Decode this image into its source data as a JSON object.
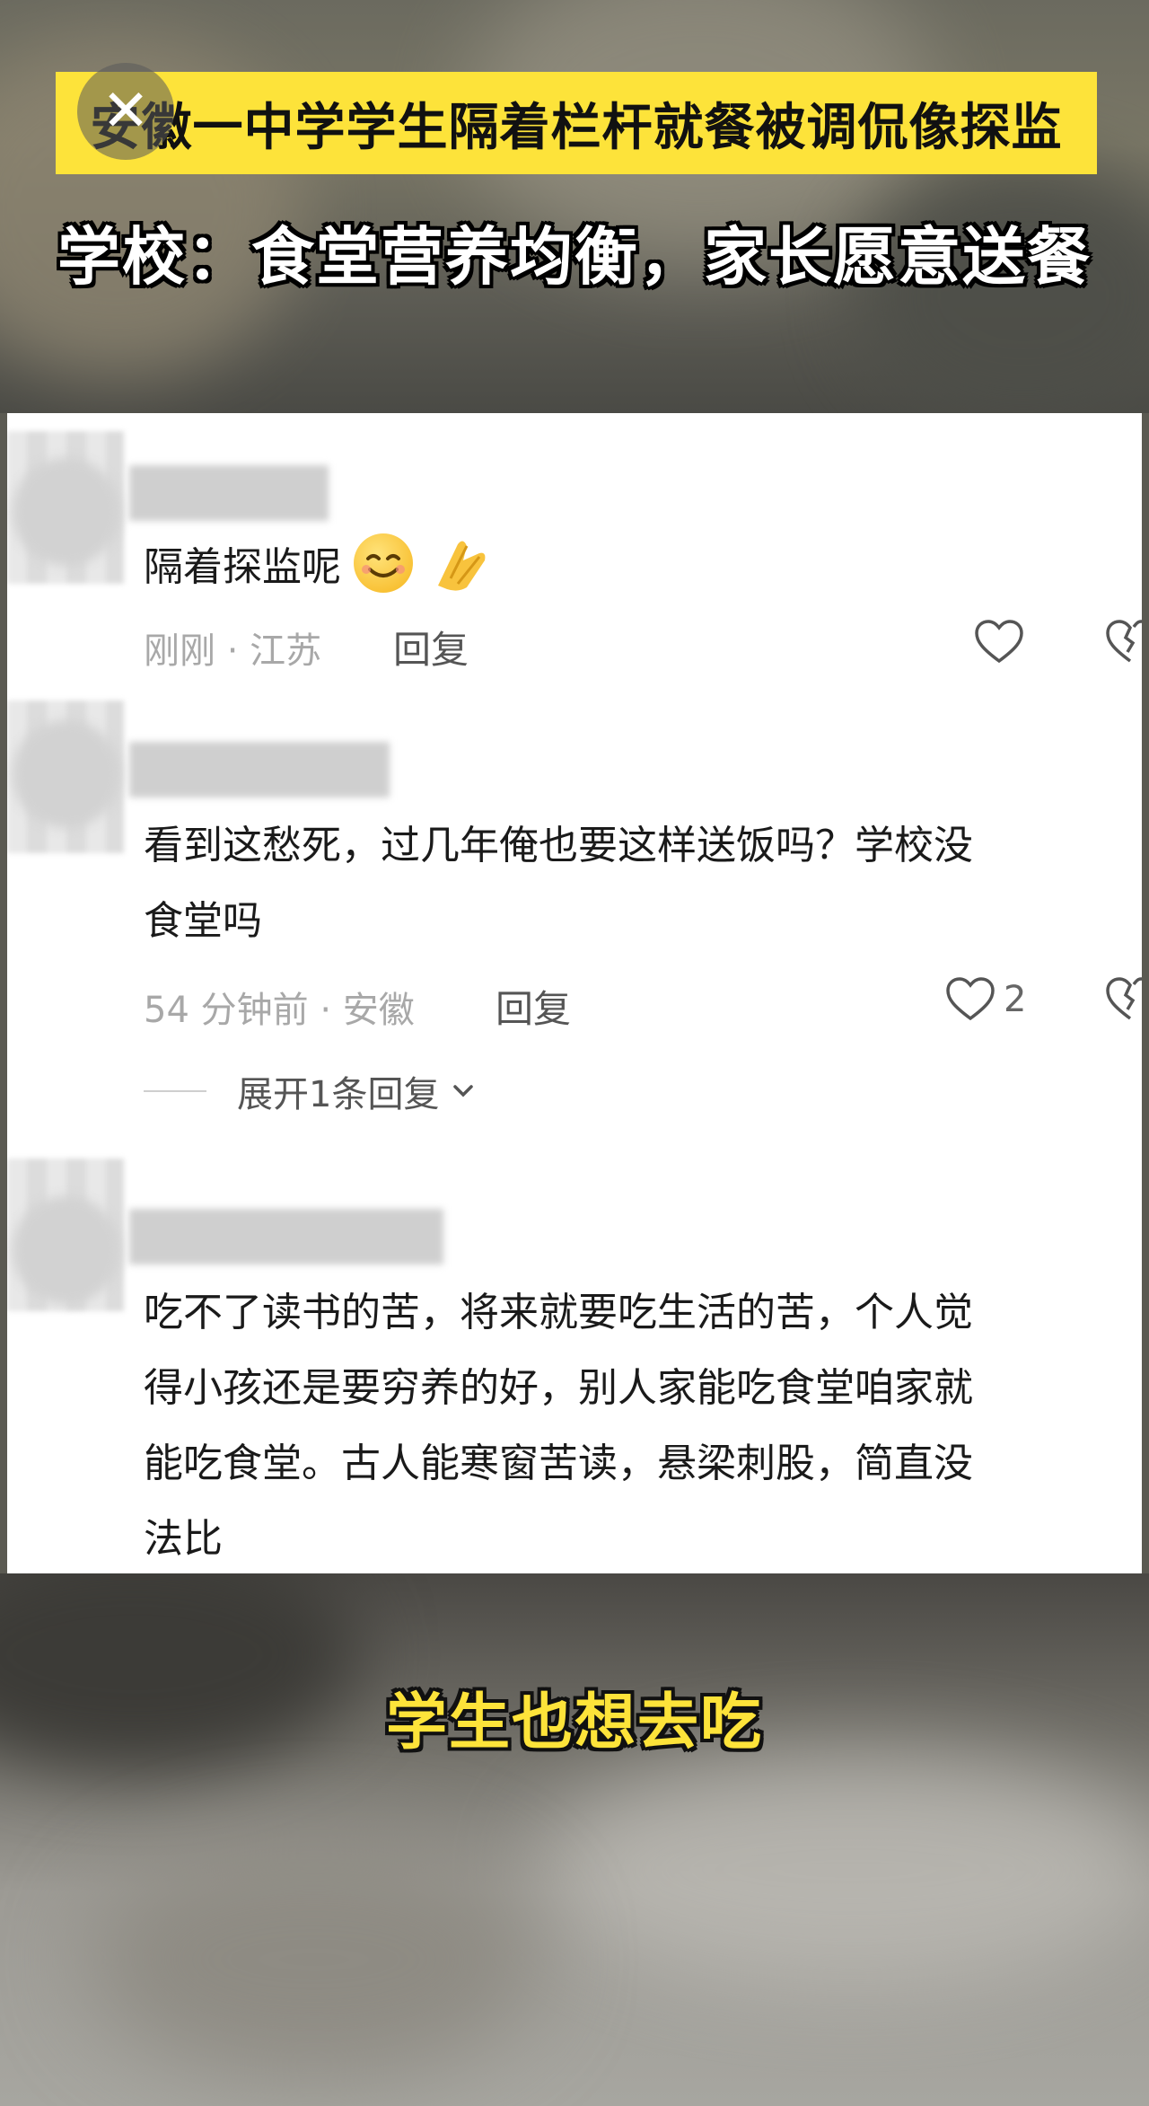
{
  "video": {
    "headline": "安徽一中学学生隔着栏杆就餐被调侃像探监",
    "subheadline": "学校：食堂营养均衡，家长愿意送餐",
    "caption": "学生也想去吃",
    "close_icon": "close-icon",
    "headline_bg_color": "#fde33a"
  },
  "comments": [
    {
      "text": "隔着探监呢",
      "emojis": [
        "smile-emoji",
        "clapping-hands-emoji"
      ],
      "time": "刚刚",
      "location": "江苏",
      "reply_label": "回复",
      "likes": ""
    },
    {
      "text_line1": "看到这愁死，过几年俺也要这样送饭吗？学校没",
      "text_line2": "食堂吗",
      "time": "54 分钟前",
      "location": "安徽",
      "reply_label": "回复",
      "likes": "2",
      "expand_label": "展开1条回复"
    },
    {
      "text_line1": "吃不了读书的苦，将来就要吃生活的苦，个人觉",
      "text_line2": "得小孩还是要穷养的好，别人家能吃食堂咱家就",
      "text_line3": "能吃食堂。古人能寒窗苦读，悬梁刺股，简直没",
      "text_line4": "法比"
    }
  ],
  "separator": "·"
}
